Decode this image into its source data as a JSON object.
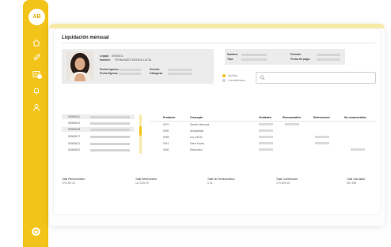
{
  "colors": {
    "accent": "#f2c318",
    "accent_light": "#f7e9a8",
    "legend_grey": "#cfcfcf"
  },
  "sidebar": {
    "avatar_initials": "AB",
    "icons": [
      "home-icon",
      "rocket-icon",
      "payroll-document-icon",
      "bell-icon",
      "user-icon"
    ],
    "logout_icon": "logout-icon"
  },
  "page": {
    "title": "Liquidación mensual"
  },
  "employee": {
    "legajo_label": "Legajo:",
    "legajo_value": "00000011",
    "nombre_label": "Nombre:",
    "nombre_value": "FERNANDEZ MONICA LUCIA",
    "fecha_ingreso_label": "Fecha Ingreso:",
    "fecha_egreso_label": "Fecha Egreso:",
    "gremio_label": "Gremio:",
    "categoria_label": "Categoría:"
  },
  "period": {
    "nombre_label": "Nombre:",
    "tipo_label": "Tipo:",
    "periodo_label": "Período:",
    "fecha_pago_label": "Fecha de pago:"
  },
  "legend": {
    "item1": "Sueldos",
    "item2": "Contabilizarse"
  },
  "search": {
    "placeholder": ""
  },
  "codes": [
    "00000011",
    "00000012",
    "00000015",
    "00000017",
    "00000021",
    "00000002"
  ],
  "table": {
    "headers": {
      "producto": "Producto",
      "concepto": "Concepto",
      "unidades": "Unidades",
      "remunerativo": "Remunerativo",
      "retenciones": "Retenciones",
      "no_remunerativo": "No remunerativo"
    },
    "rows": [
      {
        "producto": "0070",
        "concepto": "Sueldo Mensual"
      },
      {
        "producto": "0090",
        "concepto": "Antigüedad"
      },
      {
        "producto": "0095",
        "concepto": "Ley 19032"
      },
      {
        "producto": "0010",
        "concepto": "Obra Social"
      },
      {
        "producto": "0090",
        "concepto": "Redondeo"
      }
    ]
  },
  "totals": [
    {
      "label": "Total Remunerativo",
      "value": "720,090.24"
    },
    {
      "label": "Total Retenciones",
      "value": "112,616.29"
    },
    {
      "label": "Total No Remunerativo",
      "value": "0.41"
    },
    {
      "label": "Total Contribución",
      "value": "270,609.36"
    },
    {
      "label": "Total Calculado",
      "value": "587,696"
    }
  ]
}
